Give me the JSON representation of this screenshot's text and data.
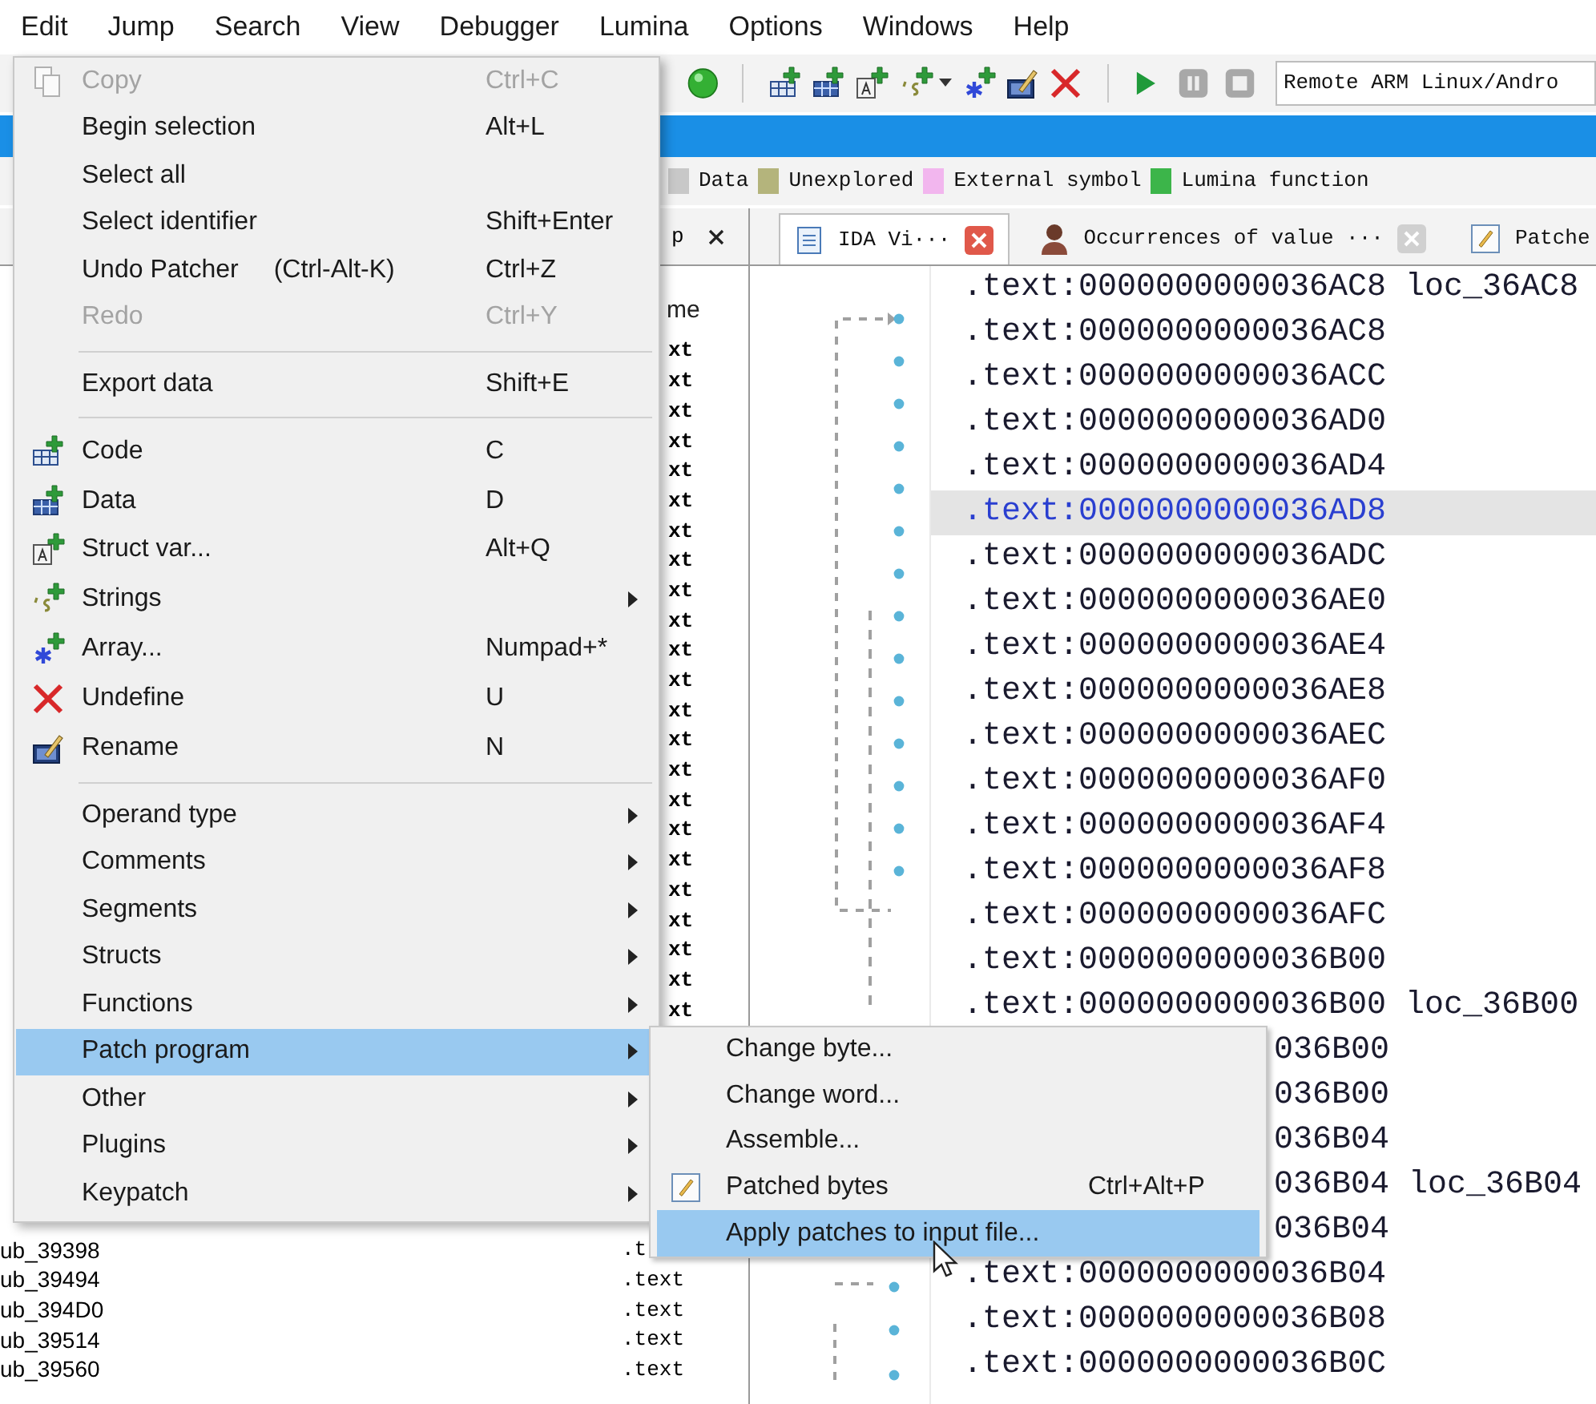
{
  "menubar": [
    {
      "label": "Edit"
    },
    {
      "label": "Jump"
    },
    {
      "label": "Search"
    },
    {
      "label": "View"
    },
    {
      "label": "Debugger"
    },
    {
      "label": "Lumina"
    },
    {
      "label": "Options"
    },
    {
      "label": "Windows"
    },
    {
      "label": "Help"
    }
  ],
  "toolbar": {
    "debugger": "Remote ARM Linux/Andro"
  },
  "legend": [
    {
      "label": "Data",
      "color": "#c8c8c8"
    },
    {
      "label": "Unexplored",
      "color": "#b4b47c"
    },
    {
      "label": "External symbol",
      "color": "#f2b6ee"
    },
    {
      "label": "Lumina function",
      "color": "#3cb54a"
    }
  ],
  "functions_panel": {
    "tab_fragment": "p",
    "header_fragment": "me",
    "partial_rows": [
      "xt",
      "xt",
      "xt",
      "xt",
      "xt",
      "xt",
      "xt",
      "xt",
      "xt",
      "xt",
      "xt",
      "xt",
      "xt",
      "xt",
      "xt",
      "xt",
      "xt",
      "xt",
      "xt",
      "xt",
      "xt",
      "xt",
      "xt"
    ],
    "rows": [
      {
        "name": "ub_39398",
        "segment": ".t"
      },
      {
        "name": "ub_39494",
        "segment": ".text"
      },
      {
        "name": "ub_394D0",
        "segment": ".text"
      },
      {
        "name": "ub_39514",
        "segment": ".text"
      },
      {
        "name": "ub_39560",
        "segment": ".text"
      }
    ]
  },
  "tabs": [
    {
      "label": "IDA Vi···",
      "selected": true
    },
    {
      "label": "Occurrences of value ···",
      "selected": false
    },
    {
      "label": "Patche",
      "selected": false,
      "cut": true
    }
  ],
  "ida_view": {
    "lines": [
      {
        "kind": "full",
        "text": ".text:0000000000036AC8",
        "label": "loc_36AC8",
        "selected": false
      },
      {
        "kind": "full",
        "text": ".text:0000000000036AC8",
        "selected": false
      },
      {
        "kind": "full",
        "text": ".text:0000000000036ACC",
        "selected": false
      },
      {
        "kind": "full",
        "text": ".text:0000000000036AD0",
        "selected": false
      },
      {
        "kind": "full",
        "text": ".text:0000000000036AD4",
        "selected": false
      },
      {
        "kind": "full",
        "text": ".text:0000000000036AD8",
        "selected": true
      },
      {
        "kind": "full",
        "text": ".text:0000000000036ADC",
        "selected": false
      },
      {
        "kind": "full",
        "text": ".text:0000000000036AE0",
        "selected": false
      },
      {
        "kind": "full",
        "text": ".text:0000000000036AE4",
        "selected": false
      },
      {
        "kind": "full",
        "text": ".text:0000000000036AE8",
        "selected": false
      },
      {
        "kind": "full",
        "text": ".text:0000000000036AEC",
        "selected": false
      },
      {
        "kind": "full",
        "text": ".text:0000000000036AF0",
        "selected": false
      },
      {
        "kind": "full",
        "text": ".text:0000000000036AF4",
        "selected": false
      },
      {
        "kind": "full",
        "text": ".text:0000000000036AF8",
        "selected": false
      },
      {
        "kind": "full",
        "text": ".text:0000000000036AFC",
        "selected": false
      },
      {
        "kind": "full",
        "text": ".text:0000000000036B00",
        "selected": false
      },
      {
        "kind": "full",
        "text": ".text:0000000000036B00",
        "label": "loc_36B00",
        "selected": false
      },
      {
        "kind": "partial",
        "text": "036B00",
        "selected": false
      },
      {
        "kind": "partial",
        "text": "036B00",
        "selected": false
      },
      {
        "kind": "partial",
        "text": "036B04",
        "selected": false
      },
      {
        "kind": "partial",
        "text": "036B04",
        "label": "loc_36B04",
        "selected": false
      },
      {
        "kind": "partial",
        "text": "036B04",
        "selected": false
      },
      {
        "kind": "full",
        "text": ".text:0000000000036B04",
        "selected": false
      },
      {
        "kind": "full",
        "text": ".text:0000000000036B08",
        "selected": false
      },
      {
        "kind": "full",
        "text": ".text:0000000000036B0C",
        "selected": false
      }
    ]
  },
  "edit_menu": [
    {
      "kind": "item",
      "label": "Copy",
      "shortcut": "Ctrl+C",
      "disabled": true,
      "selected": false
    },
    {
      "kind": "item",
      "label": "Begin selection",
      "shortcut": "Alt+L",
      "disabled": false,
      "selected": false
    },
    {
      "kind": "item",
      "label": "Select all",
      "disabled": false,
      "selected": false
    },
    {
      "kind": "item",
      "label": "Select identifier",
      "shortcut": "Shift+Enter",
      "disabled": false,
      "selected": false
    },
    {
      "kind": "item",
      "label": "Undo Patcher",
      "note": "(Ctrl-Alt-K)",
      "shortcut": "Ctrl+Z",
      "disabled": false,
      "selected": false
    },
    {
      "kind": "item",
      "label": "Redo",
      "shortcut": "Ctrl+Y",
      "disabled": true,
      "selected": false
    },
    {
      "kind": "separator"
    },
    {
      "kind": "item",
      "label": "Export data",
      "shortcut": "Shift+E",
      "disabled": false,
      "selected": false
    },
    {
      "kind": "separator"
    },
    {
      "kind": "item",
      "label": "Code",
      "shortcut": "C",
      "disabled": false,
      "selected": false
    },
    {
      "kind": "item",
      "label": "Data",
      "shortcut": "D",
      "disabled": false,
      "selected": false
    },
    {
      "kind": "item",
      "label": "Struct var...",
      "shortcut": "Alt+Q",
      "disabled": false,
      "selected": false
    },
    {
      "kind": "item",
      "label": "Strings",
      "submenu": true,
      "disabled": false,
      "selected": false
    },
    {
      "kind": "item",
      "label": "Array...",
      "shortcut": "Numpad+*",
      "disabled": false,
      "selected": false
    },
    {
      "kind": "item",
      "label": "Undefine",
      "shortcut": "U",
      "disabled": false,
      "selected": false
    },
    {
      "kind": "item",
      "label": "Rename",
      "shortcut": "N",
      "disabled": false,
      "selected": false
    },
    {
      "kind": "separator"
    },
    {
      "kind": "item",
      "label": "Operand type",
      "submenu": true,
      "disabled": false,
      "selected": false
    },
    {
      "kind": "item",
      "label": "Comments",
      "submenu": true,
      "disabled": false,
      "selected": false
    },
    {
      "kind": "item",
      "label": "Segments",
      "submenu": true,
      "disabled": false,
      "selected": false
    },
    {
      "kind": "item",
      "label": "Structs",
      "submenu": true,
      "disabled": false,
      "selected": false
    },
    {
      "kind": "item",
      "label": "Functions",
      "submenu": true,
      "disabled": false,
      "selected": false
    },
    {
      "kind": "item",
      "label": "Patch program",
      "submenu": true,
      "disabled": false,
      "selected": true
    },
    {
      "kind": "item",
      "label": "Other",
      "submenu": true,
      "disabled": false,
      "selected": false
    },
    {
      "kind": "item",
      "label": "Plugins",
      "submenu": true,
      "disabled": false,
      "selected": false
    },
    {
      "kind": "item",
      "label": "Keypatch",
      "submenu": true,
      "disabled": false,
      "selected": false
    }
  ],
  "patch_submenu": [
    {
      "label": "Change byte...",
      "selected": false
    },
    {
      "label": "Change word...",
      "selected": false
    },
    {
      "label": "Assemble...",
      "selected": false
    },
    {
      "label": "Patched bytes",
      "shortcut": "Ctrl+Alt+P",
      "selected": false
    },
    {
      "label": "Apply patches to input file...",
      "selected": true
    }
  ]
}
